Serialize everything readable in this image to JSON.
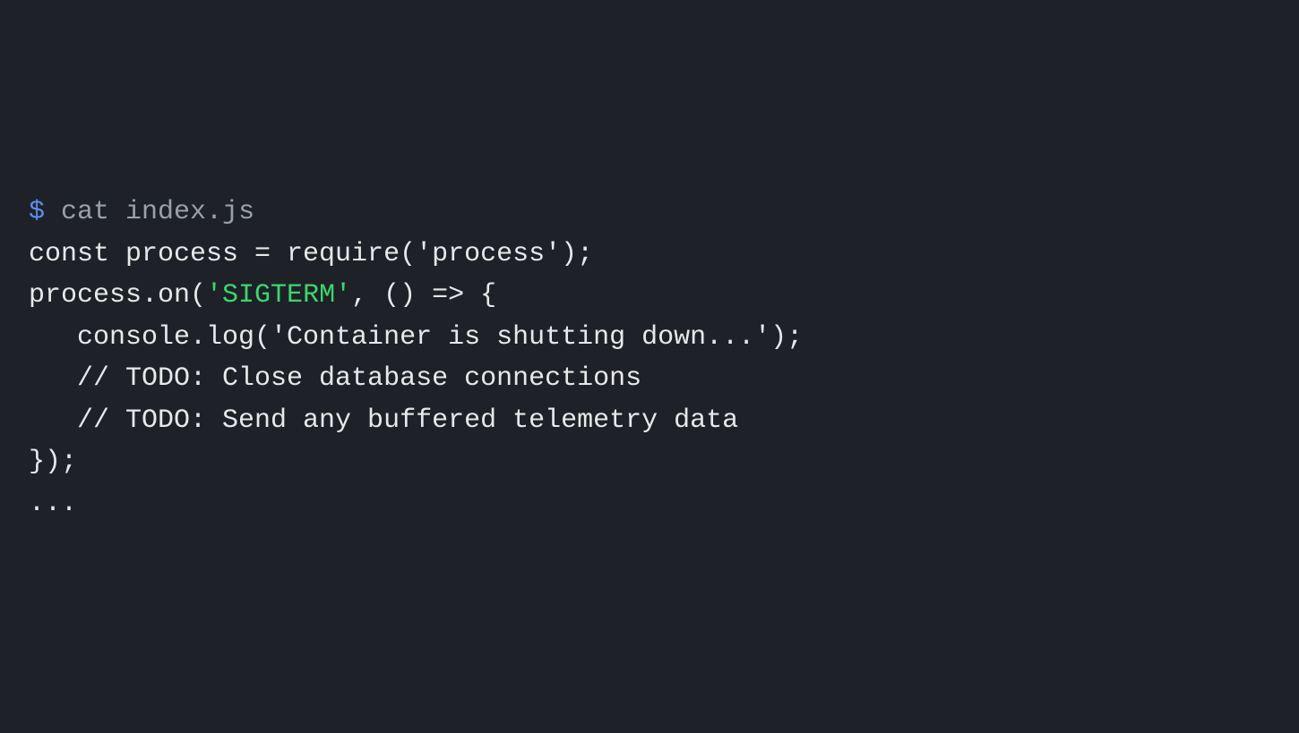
{
  "terminal": {
    "prompt": {
      "symbol": "$",
      "command": "cat index.js"
    },
    "code": {
      "l1_a": "const process = require(",
      "l1_b": "'process'",
      "l1_c": ");",
      "l2": "",
      "l3_a": "process.on(",
      "l3_b": "'SIGTERM'",
      "l3_c": ", () => {",
      "l4": "",
      "l5": "   console.log('Container is shutting down...');",
      "l6": "",
      "l7": "   // TODO: Close database connections",
      "l8": "   // TODO: Send any buffered telemetry data",
      "l9": "",
      "l10": "});",
      "l11": "",
      "l12": "..."
    }
  }
}
